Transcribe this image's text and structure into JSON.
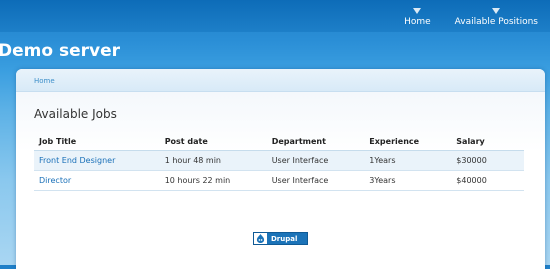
{
  "nav": {
    "items": [
      {
        "label": "Home"
      },
      {
        "label": "Available Positions"
      }
    ]
  },
  "site": {
    "name": "Demo server"
  },
  "breadcrumb": {
    "home": "Home"
  },
  "page": {
    "title": "Available Jobs"
  },
  "table": {
    "headers": [
      "Job Title",
      "Post date",
      "Department",
      "Experience",
      "Salary"
    ],
    "rows": [
      {
        "title": "Front End Designer",
        "post_date": "1 hour 48 min",
        "department": "User Interface",
        "experience": "1Years",
        "salary": "$30000"
      },
      {
        "title": "Director",
        "post_date": "10 hours 22 min",
        "department": "User Interface",
        "experience": "3Years",
        "salary": "$40000"
      }
    ]
  },
  "footer": {
    "badge_text": "Drupal"
  },
  "colors": {
    "accent": "#1a70b8",
    "header": "#1d7fc8"
  }
}
